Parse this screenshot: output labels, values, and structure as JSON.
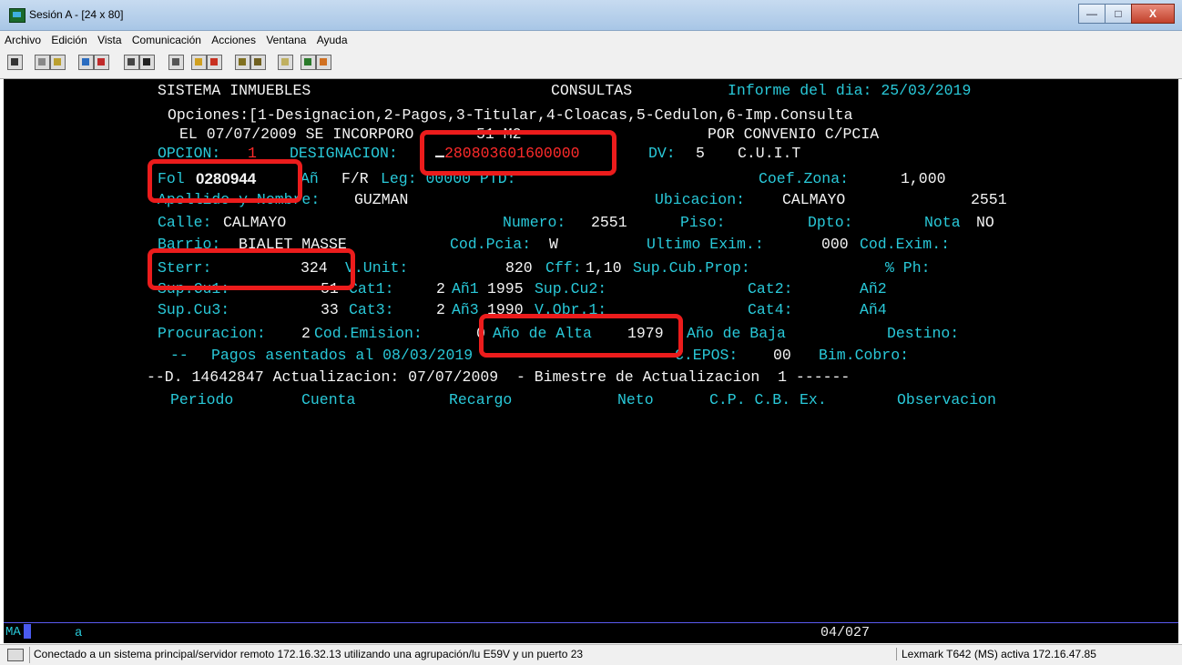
{
  "window": {
    "title": "Sesión A - [24 x 80]",
    "minimize_icon": "minimize-icon",
    "maximize_icon": "maximize-icon",
    "close_label": "X"
  },
  "menu": [
    "Archivo",
    "Edición",
    "Vista",
    "Comunicación",
    "Acciones",
    "Ventana",
    "Ayuda"
  ],
  "terminal": {
    "l1a": "SISTEMA INMUEBLES",
    "l1b": "CONSULTAS",
    "l1c": "Informe del dia: 25/03/2019",
    "l2": "Opciones:[1-Designacion,2-Pagos,3-Titular,4-Cloacas,5-Cedulon,6-Imp.Consulta",
    "l3a": "EL 07/07/2009 SE INCORPORO",
    "l3b": "51 M2",
    "l3c": "POR CONVENIO C/PCIA",
    "l4_opcion_label": "OPCION:",
    "l4_opcion_val": "1",
    "l4_desig_label": "DESIGNACION:",
    "l4_desig_val": "280803601600000",
    "l4_dv_label": "DV:",
    "l4_dv_val": "5",
    "l4_cuit": "C.U.I.T",
    "l5_fol_label": "Fol",
    "l5_fol_val": "0280944",
    "l5_an": "Añ",
    "l5_fr": "F/R",
    "l5_leg": "Leg: 00000 PTD:",
    "l5_coef_label": "Coef.Zona:",
    "l5_coef_val": "1,000",
    "l6_ape_label": "Apellido y Nombre:",
    "l6_ape_val": "GUZMAN",
    "l6_ubic_label": "Ubicacion:",
    "l6_ubic_val": "CALMAYO",
    "l6_ubic_num": "2551",
    "l7_calle_label": "Calle:",
    "l7_calle_val": "CALMAYO",
    "l7_num_label": "Numero:",
    "l7_num_val": "2551",
    "l7_piso_label": "Piso:",
    "l7_dpto_label": "Dpto:",
    "l7_nota_label": "Nota",
    "l7_nota_val": "NO",
    "l8_barrio_label": "Barrio:",
    "l8_barrio_val": "BIALET MASSE",
    "l8_codpcia_label": "Cod.Pcia:",
    "l8_codpcia_val": "W",
    "l8_ultimo_label": "Ultimo Exim.:",
    "l8_ultimo_val": "000",
    "l8_codexim_label": "Cod.Exim.:",
    "l9_sterr_label": "Sterr:",
    "l9_sterr_val": "324",
    "l9_vunit_label": "V.Unit:",
    "l9_vunit_val": "820",
    "l9_cff_label": "Cff:",
    "l9_cff_val": "1,10",
    "l9_supcub_label": "Sup.Cub.Prop:",
    "l9_ph_label": "% Ph:",
    "l10_supcu1_label": "Sup.Cu1:",
    "l10_supcu1_val": "51",
    "l10_cat1_label": "Cat1:",
    "l10_cat1_val": "2",
    "l10_an1_label": "Añ1",
    "l10_an1_val": "1995",
    "l10_supcu2_label": "Sup.Cu2:",
    "l10_cat2_label": "Cat2:",
    "l10_an2_label": "Añ2",
    "l11_supcu3_label": "Sup.Cu3:",
    "l11_supcu3_val": "33",
    "l11_cat3_label": "Cat3:",
    "l11_cat3_val": "2",
    "l11_an3_label": "Añ3",
    "l11_an3_val": "1990",
    "l11_vobr_label": "V.Obr.1:",
    "l11_cat4_label": "Cat4:",
    "l11_an4_label": "Añ4",
    "l12_proc_label": "Procuracion:",
    "l12_proc_val": "2",
    "l12_codem_label": "Cod.Emision:",
    "l12_codem_val": "0",
    "l12_alta_label": "Año de Alta",
    "l12_alta_val": "1979",
    "l12_baja_label": "Año de Baja",
    "l12_destino_label": "Destino:",
    "l13_dashes": "--",
    "l13_pagos": "Pagos asentados al 08/03/2019",
    "l13_epos_label": "C.EPOS:",
    "l13_epos_val": "00",
    "l13_bim_label": "Bim.Cobro:",
    "l14": "--D. 14642847 Actualizacion: 07/07/2009  - Bimestre de Actualizacion  1 ------",
    "l15_periodo": "Periodo",
    "l15_cuenta": "Cuenta",
    "l15_recargo": "Recargo",
    "l15_neto": "Neto",
    "l15_cpcbex": "C.P. C.B. Ex.",
    "l15_obs": "Observacion"
  },
  "status": {
    "ma": "MA",
    "a": "a",
    "position": "04/027"
  },
  "bottom": {
    "message": "Conectado a un sistema principal/servidor remoto 172.16.32.13 utilizando una agrupación/lu E59V y un puerto 23",
    "printer": "Lexmark T642 (MS) activa 172.16.47.85"
  },
  "colors": {
    "terminal_bg": "#000000",
    "field_label": "#29c9d9",
    "field_value": "#f4f4f4",
    "highlight": "#ec1c1c",
    "designation_value": "#ff2b2b"
  }
}
